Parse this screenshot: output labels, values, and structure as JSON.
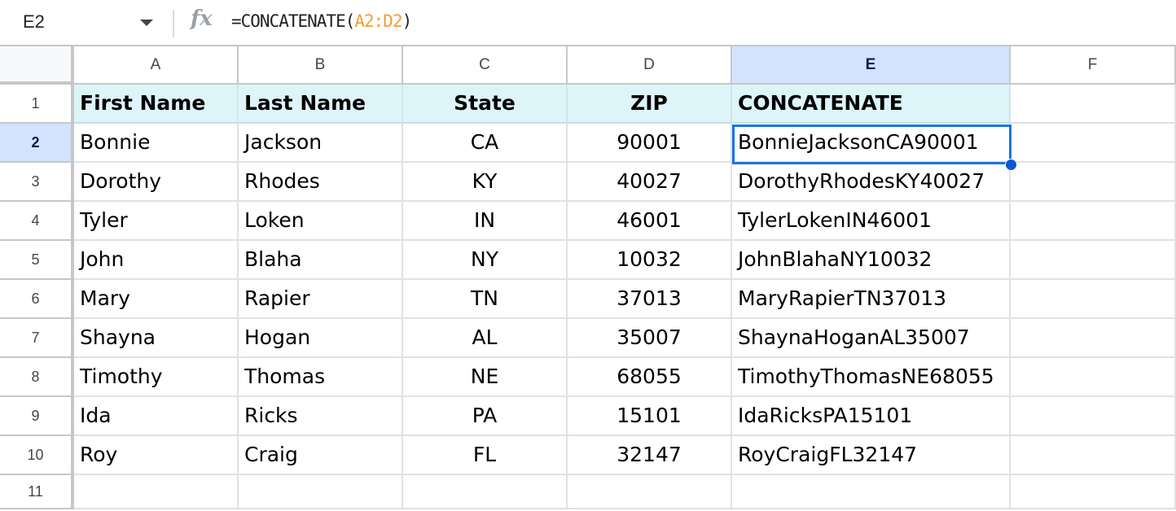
{
  "formula_bar": {
    "name_box": "E2",
    "fx_icon": "fx",
    "formula_prefix": "=CONCATENATE(",
    "formula_ref": "A2:D2",
    "formula_suffix": ")"
  },
  "columns": [
    "A",
    "B",
    "C",
    "D",
    "E",
    "F"
  ],
  "selected_column": "E",
  "selected_row": "2",
  "selected_cell": "E2",
  "row_numbers": [
    "1",
    "2",
    "3",
    "4",
    "5",
    "6",
    "7",
    "8",
    "9",
    "10",
    "11"
  ],
  "headers": [
    "First Name",
    "Last Name",
    "State",
    "ZIP",
    "CONCATENATE"
  ],
  "rows": [
    [
      "Bonnie",
      "Jackson",
      "CA",
      "90001",
      "BonnieJacksonCA90001"
    ],
    [
      "Dorothy",
      "Rhodes",
      "KY",
      "40027",
      "DorothyRhodesKY40027"
    ],
    [
      "Tyler",
      "Loken",
      "IN",
      "46001",
      "TylerLokenIN46001"
    ],
    [
      "John",
      "Blaha",
      "NY",
      "10032",
      "JohnBlahaNY10032"
    ],
    [
      "Mary",
      "Rapier",
      "TN",
      "37013",
      "MaryRapierTN37013"
    ],
    [
      "Shayna",
      "Hogan",
      "AL",
      "35007",
      "ShaynaHoganAL35007"
    ],
    [
      "Timothy",
      "Thomas",
      "NE",
      "68055",
      "TimothyThomasNE68055"
    ],
    [
      "Ida",
      "Ricks",
      "PA",
      "15101",
      "IdaRicksPA15101"
    ],
    [
      "Roy",
      "Craig",
      "FL",
      "32147",
      "RoyCraigFL32147"
    ]
  ],
  "colors": {
    "header_fill": "#ddf5f8",
    "selection": "#1a73e8",
    "selected_header": "#d3e3fd",
    "formula_ref": "#f29d38"
  }
}
